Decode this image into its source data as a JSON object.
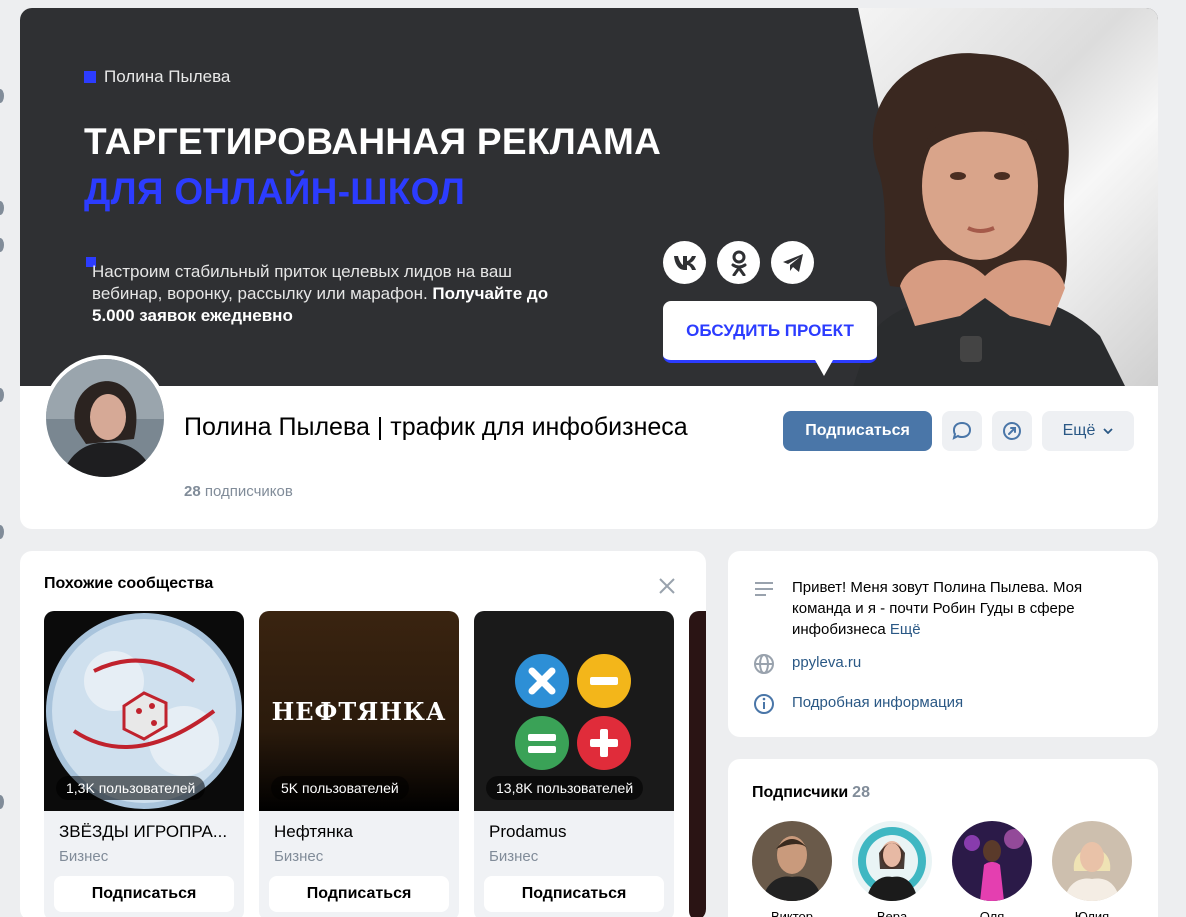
{
  "cover": {
    "author": "Полина Пылева",
    "headline_1": "ТАРГЕТИРОВАННАЯ РЕКЛАМА",
    "headline_2": "ДЛЯ ОНЛАЙН-ШКОЛ",
    "desc_plain": "Настроим стабильный приток целевых лидов на ваш вебинар, воронку, рассылку или марафон.",
    "desc_bold": "Получайте до 5.000 заявок ежедневно",
    "social": [
      "vk-icon",
      "odnoklassniki-icon",
      "telegram-icon"
    ],
    "discuss_label": "ОБСУДИТЬ ПРОЕКТ",
    "colors": {
      "accent": "#2c3cff",
      "background": "#2f3033"
    }
  },
  "profile": {
    "title": "Полина Пылева | трафик для инфобизнеса",
    "subscribers_count": "28",
    "subscribers_label": "подписчиков",
    "subscribe_label": "Подписаться",
    "more_label": "Ещё",
    "accent": "#4a76a8"
  },
  "similar": {
    "title": "Похожие сообщества",
    "items": [
      {
        "name": "ЗВЁЗДЫ ИГРОПРА...",
        "category": "Бизнес",
        "members": "1,3K пользователей",
        "button": "Подписаться"
      },
      {
        "name": "Нефтянка",
        "category": "Бизнес",
        "members": "5K пользователей",
        "button": "Подписаться",
        "logo_text": "НЕФТЯНКА"
      },
      {
        "name": "Prodamus",
        "category": "Бизнес",
        "members": "13,8K пользователей",
        "button": "Подписаться"
      }
    ]
  },
  "info": {
    "about": "Привет! Меня зовут Полина Пылева. Моя команда и я - почти Робин Гуды в сфере инфобизнеса",
    "about_more": "Ещё",
    "website": "ppyleva.ru",
    "details": "Подробная информация"
  },
  "subs": {
    "title": "Подписчики",
    "count": "28",
    "people": [
      "Виктор",
      "Вера",
      "Оля",
      "Юлия"
    ]
  }
}
